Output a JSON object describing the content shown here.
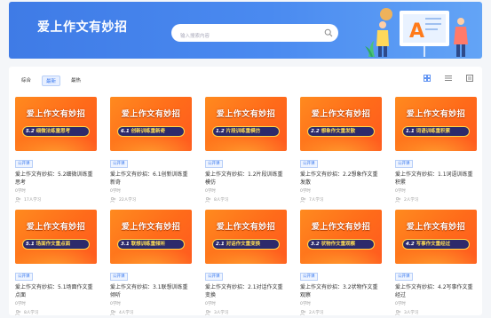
{
  "header": {
    "title": "爱上作文有妙招",
    "search_placeholder": "输入搜索内容",
    "illustration_letter": "A"
  },
  "filters": [
    "综合",
    "最新",
    "最热"
  ],
  "active_filter": 1,
  "view_icons": [
    "grid-view-icon",
    "list-view-icon",
    "detail-view-icon"
  ],
  "colors": {
    "accent": "#3a7af0",
    "banner": "#4a8af0",
    "thumb": "#ff6b1a"
  },
  "thumb_title": "爱上作文有妙招",
  "courses": [
    {
      "num": "5.2",
      "sub": "细微法练童思考",
      "tag": "公开课",
      "name": "爱上作文有妙招：5.2细微训练重思考",
      "author": "0学时",
      "learners": "17人学习"
    },
    {
      "num": "6.1",
      "sub": "创新训练重新奇",
      "tag": "公开课",
      "name": "爱上作文有妙招：6.1创新训练重新奇",
      "author": "0学时",
      "learners": "22人学习"
    },
    {
      "num": "1.2",
      "sub": "片段训练重模仿",
      "tag": "公开课",
      "name": "爱上作文有妙招：1.2片段训练重模仿",
      "author": "0学时",
      "learners": "8人学习"
    },
    {
      "num": "2.2",
      "sub": "想象作文重发散",
      "tag": "公开课",
      "name": "爱上作文有妙招：2.2想象作文重发散",
      "author": "0学时",
      "learners": "7人学习"
    },
    {
      "num": "1.1",
      "sub": "词语训练重积累",
      "tag": "公开课",
      "name": "爱上作文有妙招：1.1词语训练重积累",
      "author": "0学时",
      "learners": "2人学习"
    },
    {
      "num": "5.1",
      "sub": "场面作文重点面",
      "tag": "公开课",
      "name": "爱上作文有妙招：5.1场面作文重点面",
      "author": "0学时",
      "learners": "8人学习"
    },
    {
      "num": "3.1",
      "sub": "联想训练重倾听",
      "tag": "公开课",
      "name": "爱上作文有妙招：3.1联想训练重倾听",
      "author": "0学时",
      "learners": "4人学习"
    },
    {
      "num": "2.1",
      "sub": "对话作文重变换",
      "tag": "公开课",
      "name": "爱上作文有妙招：2.1对话作文重变换",
      "author": "0学时",
      "learners": "3人学习"
    },
    {
      "num": "3.2",
      "sub": "状物作文重观察",
      "tag": "公开课",
      "name": "爱上作文有妙招：3.2状物作文重观察",
      "author": "0学时",
      "learners": "2人学习"
    },
    {
      "num": "4.2",
      "sub": "写事作文重经过",
      "tag": "公开课",
      "name": "爱上作文有妙招：4.2写事作文重经过",
      "author": "0学时",
      "learners": "3人学习"
    }
  ]
}
